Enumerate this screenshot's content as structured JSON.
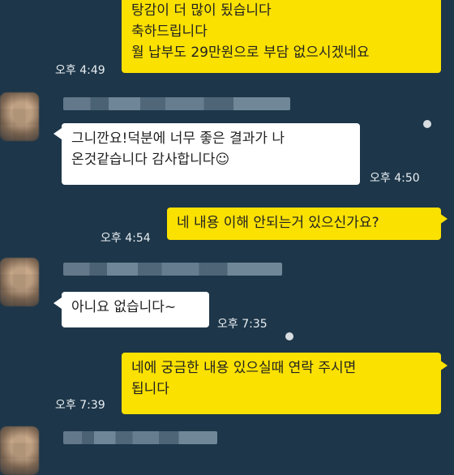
{
  "messages": [
    {
      "text": "탕감이 더 많이 됬습니다\n축하드립니다\n월 납부도 29만원으로 부담 없으시겠네요",
      "time": "오후 4:49"
    },
    {
      "text": "그니깐요!덕분에 너무 좋은 결과가 나\n온것같습니다 감사합니다☺",
      "time": "오후 4:50"
    },
    {
      "text": "네 내용 이해 안되는거 있으신가요?",
      "time": "오후 4:54"
    },
    {
      "text": "아니요 없습니다~",
      "time": "오후 7:35"
    },
    {
      "text": "네에 궁금한 내용 있으실때 연락 주시면\n됩니다",
      "time": "오후 7:39"
    }
  ],
  "colors": {
    "background": "#1d3649",
    "outgoing": "#fae100",
    "incoming": "#ffffff"
  }
}
